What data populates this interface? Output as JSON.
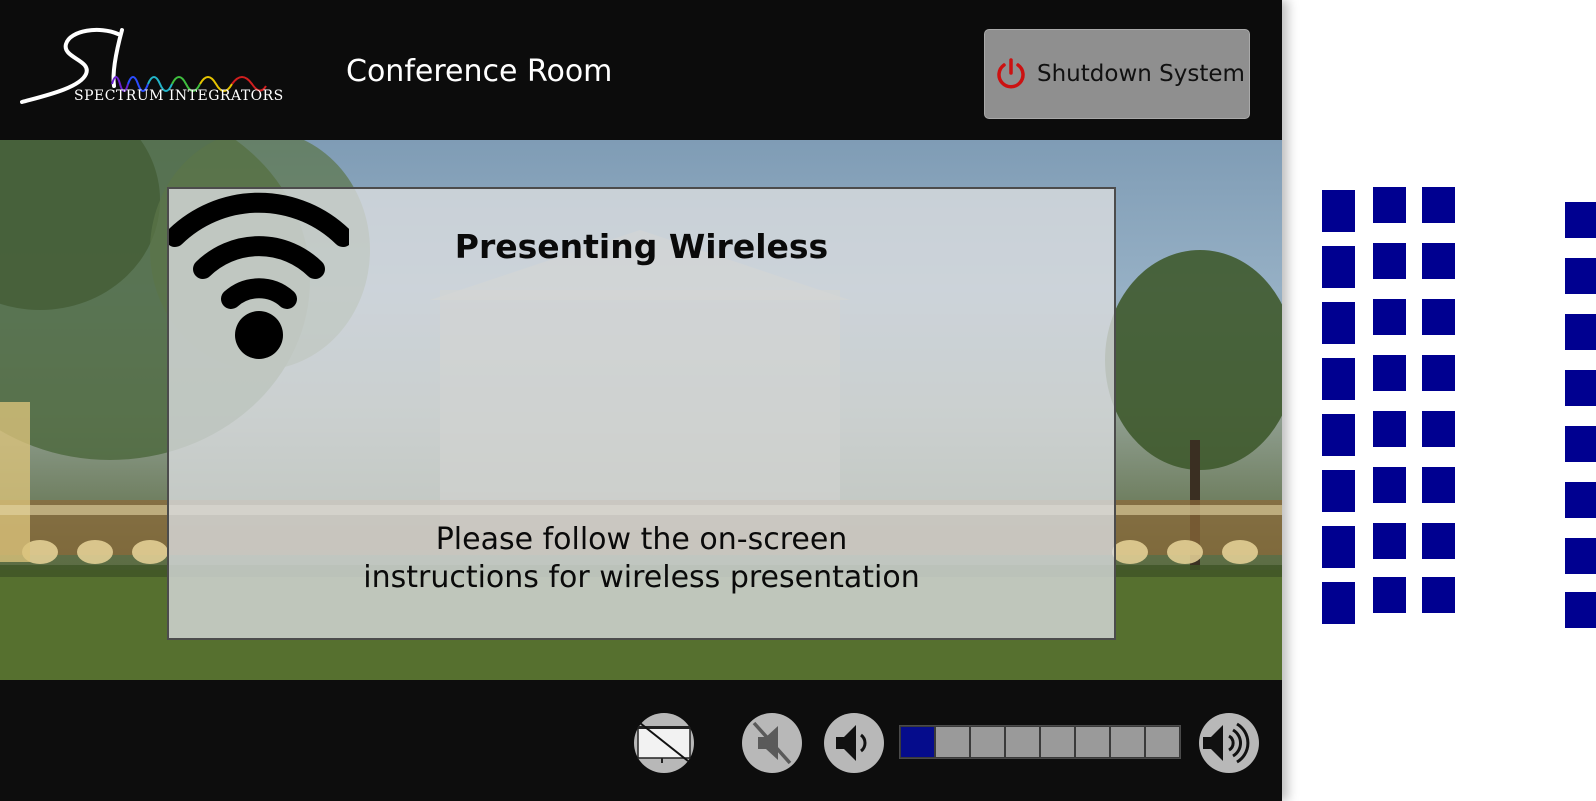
{
  "header": {
    "logo_text": "SPECTRUM INTEGRATORS",
    "room_title": "Conference Room",
    "shutdown_label": "Shutdown System",
    "shutdown_icon": "power-icon"
  },
  "modal": {
    "title": "Presenting Wireless",
    "icon": "wifi-icon",
    "body_line1": "Please follow the on-screen",
    "body_line2": "instructions for wireless presentation"
  },
  "footer": {
    "display_off_icon": "display-off-icon",
    "mute_icon": "mute-icon",
    "volume_down_icon": "volume-down-icon",
    "volume_up_icon": "volume-up-icon",
    "volume_level": 1,
    "volume_steps": 8
  },
  "colors": {
    "accent": "#000090",
    "power_icon": "#cc1111",
    "header_bg": "#0c0c0c",
    "button_gray": "#8f8f8f"
  }
}
